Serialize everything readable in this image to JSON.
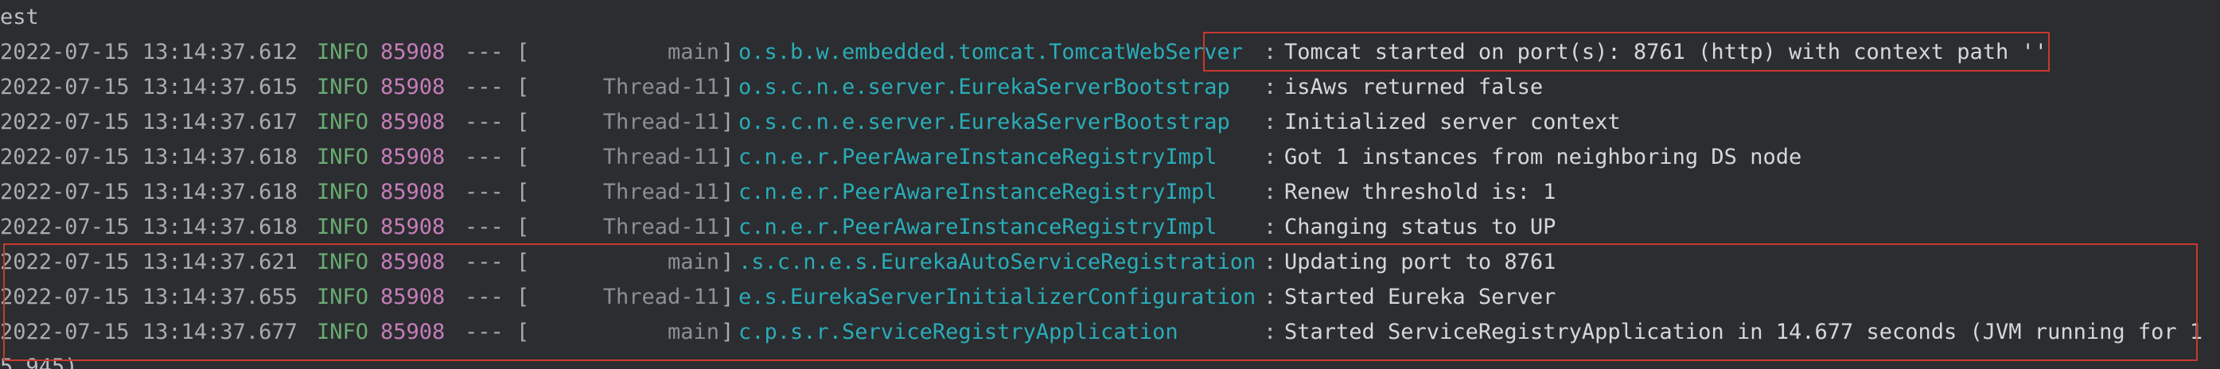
{
  "console": {
    "top_fragment": "est",
    "bottom_fragment": "5.945)",
    "lines": [
      {
        "timestamp": "2022-07-15 13:14:37.612",
        "level": "INFO",
        "pid": "85908",
        "sep": "--- [",
        "thread": "main",
        "bracket": "]",
        "logger": "o.s.b.w.embedded.tomcat.TomcatWebServer",
        "colon": ":",
        "message": "Tomcat started on port(s): 8761 (http) with context path ''"
      },
      {
        "timestamp": "2022-07-15 13:14:37.615",
        "level": "INFO",
        "pid": "85908",
        "sep": "--- [",
        "thread": "Thread-11",
        "bracket": "]",
        "logger": "o.s.c.n.e.server.EurekaServerBootstrap",
        "colon": ":",
        "message": "isAws returned false"
      },
      {
        "timestamp": "2022-07-15 13:14:37.617",
        "level": "INFO",
        "pid": "85908",
        "sep": "--- [",
        "thread": "Thread-11",
        "bracket": "]",
        "logger": "o.s.c.n.e.server.EurekaServerBootstrap",
        "colon": ":",
        "message": "Initialized server context"
      },
      {
        "timestamp": "2022-07-15 13:14:37.618",
        "level": "INFO",
        "pid": "85908",
        "sep": "--- [",
        "thread": "Thread-11",
        "bracket": "]",
        "logger": "c.n.e.r.PeerAwareInstanceRegistryImpl",
        "colon": ":",
        "message": "Got 1 instances from neighboring DS node"
      },
      {
        "timestamp": "2022-07-15 13:14:37.618",
        "level": "INFO",
        "pid": "85908",
        "sep": "--- [",
        "thread": "Thread-11",
        "bracket": "]",
        "logger": "c.n.e.r.PeerAwareInstanceRegistryImpl",
        "colon": ":",
        "message": "Renew threshold is: 1"
      },
      {
        "timestamp": "2022-07-15 13:14:37.618",
        "level": "INFO",
        "pid": "85908",
        "sep": "--- [",
        "thread": "Thread-11",
        "bracket": "]",
        "logger": "c.n.e.r.PeerAwareInstanceRegistryImpl",
        "colon": ":",
        "message": "Changing status to UP"
      },
      {
        "timestamp": "2022-07-15 13:14:37.621",
        "level": "INFO",
        "pid": "85908",
        "sep": "--- [",
        "thread": "main",
        "bracket": "]",
        "logger": ".s.c.n.e.s.EurekaAutoServiceRegistration",
        "colon": ":",
        "message": "Updating port to 8761"
      },
      {
        "timestamp": "2022-07-15 13:14:37.655",
        "level": "INFO",
        "pid": "85908",
        "sep": "--- [",
        "thread": "Thread-11",
        "bracket": "]",
        "logger": "e.s.EurekaServerInitializerConfiguration",
        "colon": ":",
        "message": "Started Eureka Server"
      },
      {
        "timestamp": "2022-07-15 13:14:37.677",
        "level": "INFO",
        "pid": "85908",
        "sep": "--- [",
        "thread": "main",
        "bracket": "]",
        "logger": "c.p.s.r.ServiceRegistryApplication",
        "colon": ":",
        "message": "Started ServiceRegistryApplication in 14.677 seconds (JVM running for 1"
      }
    ]
  },
  "colors": {
    "background": "#2b2d30",
    "highlight_border": "#c8392f",
    "level_info": "#6aab73",
    "pid": "#c77dbb",
    "logger": "#2aacb8"
  }
}
